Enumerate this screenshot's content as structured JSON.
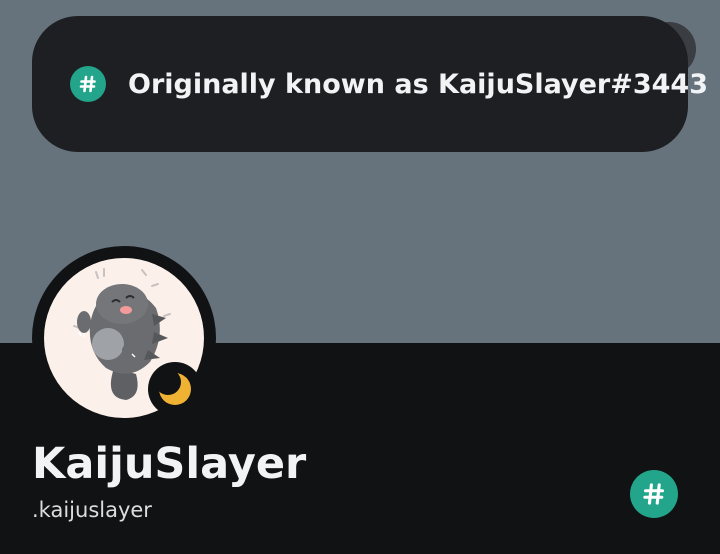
{
  "tooltip": {
    "icon": "hashtag-icon",
    "text": "Originally known as KaijuSlayer#3443"
  },
  "profile": {
    "display_name": "KaijuSlayer",
    "username": ".kaijuslayer",
    "status_icon": "moon-icon",
    "status_color": "#f0b232",
    "badge_icon": "hashtag-icon",
    "badge_color": "#23a58c"
  },
  "colors": {
    "banner": "#66737d",
    "background": "#111214",
    "tooltip_bg": "#1e1f22"
  }
}
